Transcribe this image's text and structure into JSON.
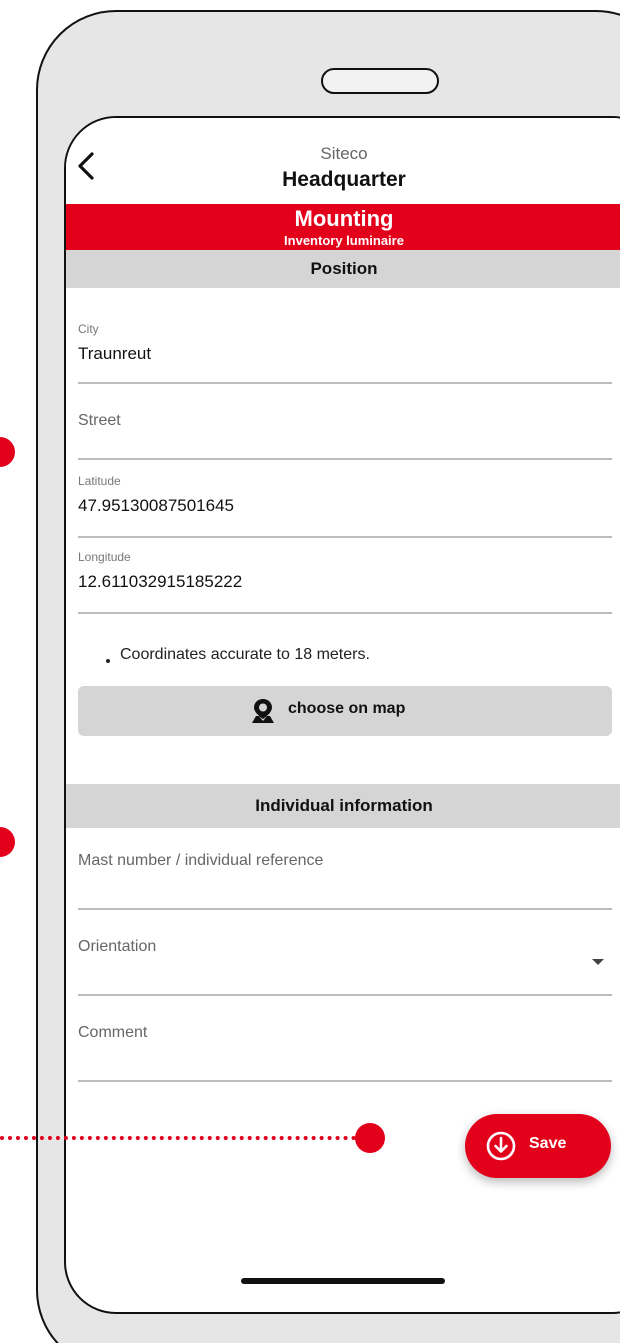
{
  "header": {
    "back_icon": "chevron-left-icon",
    "subtitle": "Siteco",
    "title": "Headquarter"
  },
  "banner": {
    "title": "Mounting",
    "subtitle": "Inventory luminaire",
    "color": "#e2001a"
  },
  "position_section": {
    "title": "Position",
    "fields": {
      "city": {
        "label": "City",
        "value": "Traunreut"
      },
      "street": {
        "placeholder": "Street"
      },
      "latitude": {
        "label": "Latitude",
        "value": "47.95130087501645"
      },
      "longitude": {
        "label": "Longitude",
        "value": "12.611032915185222"
      }
    },
    "accuracy_text": "Coordinates accurate to 18 meters.",
    "map_button": {
      "icon": "map-pin-icon",
      "label": "choose on map"
    }
  },
  "individual_section": {
    "title": "Individual information",
    "toggle_icon": "chevron-up-icon",
    "fields": {
      "mast_number": {
        "placeholder": "Mast number / individual reference"
      },
      "orientation": {
        "placeholder": "Orientation",
        "icon": "dropdown-caret-icon"
      },
      "comment": {
        "placeholder": "Comment"
      }
    }
  },
  "save_button": {
    "label": "Save",
    "icon": "download-circle-icon",
    "color": "#e2001a"
  }
}
